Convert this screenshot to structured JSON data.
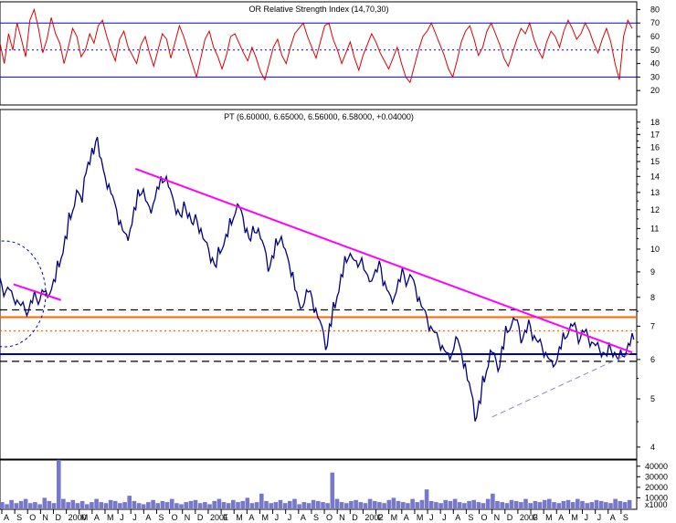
{
  "chart_data": [
    {
      "type": "line",
      "panel": "rsi",
      "title": "OR Relative Strength Index (14,70,30)",
      "ylim": [
        10,
        85
      ],
      "yticks": [
        20,
        30,
        40,
        50,
        60,
        70,
        80
      ],
      "reference_lines": [
        {
          "value": 70,
          "style": "solid",
          "color": "#0000ff"
        },
        {
          "value": 50,
          "style": "dotted",
          "color": "#0000ff"
        },
        {
          "value": 30,
          "style": "solid",
          "color": "#0000ff"
        }
      ],
      "series": [
        {
          "color": "#dd0000",
          "values": [
            55,
            40,
            62,
            50,
            70,
            58,
            45,
            72,
            80,
            66,
            48,
            58,
            74,
            62,
            55,
            40,
            52,
            66,
            60,
            45,
            50,
            62,
            55,
            68,
            72,
            60,
            50,
            42,
            58,
            64,
            52,
            46,
            40,
            54,
            60,
            48,
            38,
            50,
            62,
            58,
            44,
            56,
            68,
            60,
            50,
            40,
            30,
            44,
            58,
            64,
            52,
            45,
            36,
            46,
            60,
            62,
            55,
            48,
            42,
            52,
            44,
            34,
            28,
            40,
            52,
            58,
            46,
            40,
            52,
            62,
            66,
            70,
            60,
            52,
            44,
            56,
            68,
            70,
            58,
            50,
            40,
            48,
            56,
            44,
            35,
            46,
            54,
            62,
            56,
            48,
            42,
            36,
            44,
            52,
            40,
            30,
            26,
            38,
            50,
            60,
            64,
            70,
            62,
            54,
            46,
            36,
            30,
            42,
            56,
            64,
            68,
            58,
            46,
            52,
            64,
            70,
            62,
            54,
            44,
            38,
            48,
            58,
            66,
            62,
            70,
            58,
            50,
            44,
            56,
            64,
            60,
            52,
            64,
            72,
            66,
            58,
            62,
            70,
            64,
            55,
            48,
            58,
            66,
            56,
            40,
            28,
            60,
            72,
            66
          ]
        }
      ]
    },
    {
      "type": "line",
      "panel": "price",
      "title": "PT (6.60000, 6.65000, 6.56000, 6.58000, +0.04000)",
      "yscale": "log",
      "ylim": [
        3.8,
        19
      ],
      "yticks": [
        4,
        5,
        6,
        7,
        8,
        9,
        10,
        11,
        12,
        13,
        14,
        15,
        16,
        17,
        18
      ],
      "x_labels": [
        "A",
        "S",
        "O",
        "N",
        "D",
        "2000",
        "M",
        "A",
        "M",
        "J",
        "J",
        "A",
        "S",
        "O",
        "N",
        "D",
        "2001",
        "F",
        "M",
        "A",
        "M",
        "J",
        "J",
        "A",
        "S",
        "O",
        "N",
        "D",
        "2002",
        "F",
        "M",
        "A",
        "M",
        "J",
        "J",
        "A",
        "S",
        "O",
        "N",
        "D",
        "2003",
        "F",
        "M",
        "A",
        "M",
        "J",
        "J",
        "A",
        "S"
      ],
      "reference_lines": [
        {
          "value": 7.55,
          "style": "dashed",
          "color": "#000000"
        },
        {
          "value": 7.3,
          "style": "solid",
          "color": "#ff6600"
        },
        {
          "value": 6.85,
          "style": "dotted",
          "color": "#ff6600"
        },
        {
          "value": 6.15,
          "style": "solid",
          "color": "#0000cc"
        },
        {
          "value": 5.95,
          "style": "dashed",
          "color": "#000000"
        }
      ],
      "trendlines": [
        {
          "from": [
            6,
            8.5
          ],
          "to": [
            27,
            7.9
          ],
          "color": "#ff00ff"
        },
        {
          "from": [
            60,
            14.5
          ],
          "to": [
            280,
            6.2
          ],
          "color": "#ff00ff"
        },
        {
          "from": [
            218,
            4.6
          ],
          "to": [
            280,
            6.2
          ],
          "color": "#8888cc",
          "style": "dashed"
        }
      ],
      "series": [
        {
          "name": "PT",
          "color": "#000080",
          "values": [
            8.5,
            8.2,
            8.3,
            8.0,
            7.9,
            7.7,
            7.6,
            7.5,
            7.8,
            8.0,
            7.9,
            8.2,
            8.0,
            8.3,
            8.6,
            9.2,
            9.8,
            10.5,
            11.5,
            12.2,
            13.0,
            12.4,
            14.2,
            14.8,
            15.5,
            16.8,
            15.2,
            14.0,
            13.5,
            12.8,
            12.0,
            11.4,
            10.8,
            10.4,
            11.2,
            12.0,
            12.8,
            13.2,
            12.4,
            11.8,
            12.6,
            13.2,
            13.6,
            14.0,
            13.2,
            12.4,
            12.0,
            11.6,
            12.1,
            11.8,
            11.2,
            11.4,
            11.0,
            10.4,
            10.0,
            9.6,
            9.2,
            9.8,
            10.2,
            10.6,
            11.2,
            11.8,
            12.2,
            11.6,
            11.0,
            10.4,
            10.8,
            11.0,
            10.4,
            9.8,
            9.2,
            9.6,
            10.2,
            10.6,
            10.0,
            9.4,
            9.0,
            8.2,
            7.6,
            7.8,
            8.2,
            8.0,
            7.6,
            7.2,
            6.8,
            6.4,
            7.0,
            7.6,
            8.2,
            8.8,
            9.4,
            9.8,
            9.5,
            9.2,
            9.6,
            9.0,
            8.6,
            8.8,
            9.0,
            9.2,
            8.6,
            8.2,
            7.8,
            8.2,
            8.6,
            8.9,
            8.6,
            8.8,
            8.4,
            8.0,
            7.6,
            7.3,
            7.0,
            6.8,
            6.6,
            6.4,
            6.2,
            6.0,
            6.3,
            6.6,
            6.2,
            5.9,
            5.4,
            5.0,
            4.6,
            4.9,
            5.4,
            5.8,
            6.2,
            6.0,
            5.8,
            6.3,
            6.8,
            7.0,
            7.2,
            7.0,
            6.6,
            6.8,
            7.0,
            6.7,
            6.5,
            6.4,
            6.2,
            6.0,
            5.8,
            6.0,
            6.3,
            6.6,
            6.8,
            7.0,
            6.9,
            6.6,
            6.8,
            6.7,
            6.5,
            6.4,
            6.3,
            6.2,
            6.1,
            6.3,
            6.2,
            6.0,
            6.1,
            6.2,
            6.4,
            6.58
          ]
        }
      ]
    },
    {
      "type": "bar",
      "panel": "volume",
      "ylim": [
        0,
        45000
      ],
      "ytick_labels": [
        "40000",
        "30000",
        "20000",
        "10000",
        "x1000"
      ],
      "yticks": [
        40000,
        30000,
        20000,
        10000
      ],
      "series": [
        {
          "color": "#7777cc",
          "values": [
            6000,
            4000,
            8000,
            5000,
            7000,
            9000,
            5000,
            6000,
            4000,
            10000,
            7000,
            5000,
            46000,
            9000,
            6000,
            8000,
            5000,
            7000,
            4000,
            6000,
            9000,
            6000,
            5000,
            8000,
            7000,
            5000,
            6000,
            12000,
            7000,
            5000,
            4000,
            6000,
            8000,
            5000,
            7000,
            6000,
            9000,
            5000,
            4000,
            6000,
            7000,
            8000,
            5000,
            6000,
            4000,
            7000,
            9000,
            6000,
            5000,
            8000,
            6000,
            7000,
            10000,
            5000,
            6000,
            14000,
            7000,
            5000,
            6000,
            8000,
            5000,
            7000,
            9000,
            4000,
            6000,
            5000,
            8000,
            7000,
            6000,
            5000,
            34000,
            9000,
            6000,
            5000,
            7000,
            8000,
            6000,
            5000,
            9000,
            7000,
            6000,
            5000,
            8000,
            10000,
            7000,
            6000,
            5000,
            9000,
            6000,
            8000,
            18000,
            7000,
            6000,
            5000,
            8000,
            7000,
            9000,
            6000,
            5000,
            7000,
            8000,
            6000,
            5000,
            9000,
            14000,
            7000,
            6000,
            5000,
            8000,
            7000,
            6000,
            9000,
            5000,
            7000,
            6000,
            8000,
            9000,
            6000,
            5000,
            7000,
            8000,
            6000,
            9000,
            7000,
            5000,
            6000,
            8000,
            7000,
            6000,
            5000,
            9000,
            7000,
            6000,
            8000
          ]
        }
      ]
    }
  ]
}
